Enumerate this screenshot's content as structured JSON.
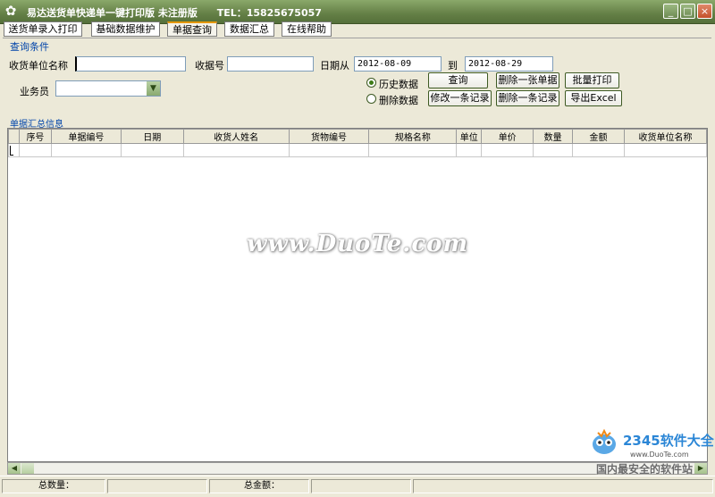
{
  "window": {
    "title": "易达送货单快递单一键打印版  未注册版",
    "tel": "TEL：15825675057",
    "controls": [
      "_",
      "□",
      "×"
    ]
  },
  "tabs": [
    {
      "label": "送货单录入打印",
      "active": false
    },
    {
      "label": "基础数据维护",
      "active": false
    },
    {
      "label": "单据查询",
      "active": true
    },
    {
      "label": "数据汇总",
      "active": false
    },
    {
      "label": "在线帮助",
      "active": false
    }
  ],
  "query": {
    "section_title": "查询条件",
    "customer_label": "收货单位名称",
    "customer_value": "",
    "receipt_label": "收据号",
    "receipt_value": "",
    "date_from_label": "日期从",
    "date_from": "2012-08-09",
    "date_to_label": "到",
    "date_to": "2012-08-29",
    "salesman_label": "业务员",
    "salesman_value": "",
    "radio_history": "历史数据",
    "radio_deleted": "删除数据",
    "history_selected": true,
    "btn_query": "查询",
    "btn_delete_doc": "删除一张单据",
    "btn_batch_print": "批量打印",
    "btn_modify_record": "修改一条记录",
    "btn_delete_record": "删除一条记录",
    "btn_export": "导出Excel"
  },
  "grid": {
    "section_title": "单据汇总信息",
    "columns": [
      "序号",
      "单据编号",
      "日期",
      "收货人姓名",
      "货物编号",
      "规格名称",
      "单位",
      "单价",
      "数量",
      "金额",
      "收货单位名称"
    ],
    "rows": []
  },
  "status": {
    "total_qty_label": "总数量：",
    "total_qty": "",
    "total_amount_label": "总金额：",
    "total_amount": ""
  },
  "watermark": {
    "text": "www.DuoTe.com",
    "logo_main": "2345软件大全",
    "logo_url": "www.DuoTe.com",
    "logo_slogan": "国内最安全的软件站"
  },
  "colors": {
    "titlebar": "#647f46",
    "panel": "#ECE9D8",
    "section_text": "#0044aa",
    "active_tab_accent": "#e59700"
  }
}
